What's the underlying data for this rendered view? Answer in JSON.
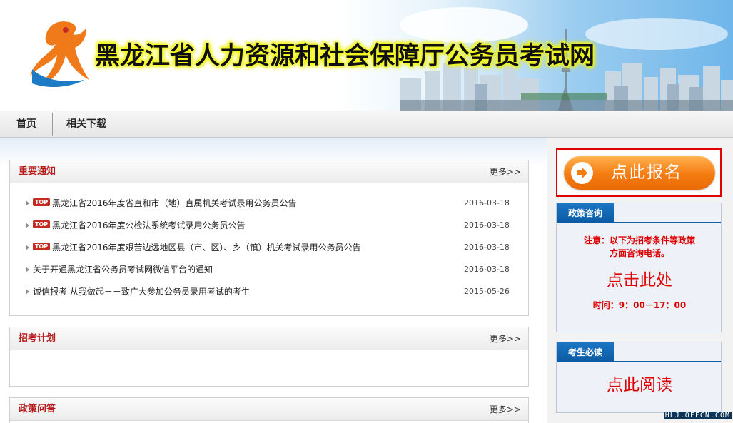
{
  "header": {
    "site_title": "黑龙江省人力资源和社会保障厅公务员考试网"
  },
  "nav": {
    "items": [
      {
        "label": "首页"
      },
      {
        "label": "相关下载"
      }
    ]
  },
  "notices": {
    "title": "重要通知",
    "more": "更多>>",
    "top_tag": "TOP",
    "items": [
      {
        "title": "黑龙江省2016年度省直和市（地）直属机关考试录用公务员公告",
        "date": "2016-03-18",
        "top": true
      },
      {
        "title": "黑龙江省2016年度公检法系统考试录用公务员公告",
        "date": "2016-03-18",
        "top": true
      },
      {
        "title": "黑龙江省2016年度艰苦边远地区县（市、区）、乡（镇）机关考试录用公务员公告",
        "date": "2016-03-18",
        "top": true
      },
      {
        "title": "关于开通黑龙江省公务员考试网微信平台的通知",
        "date": "2016-03-18",
        "top": false
      },
      {
        "title": "诚信报考 从我做起－－致广大参加公务员录用考试的考生",
        "date": "2015-05-26",
        "top": false
      }
    ]
  },
  "plan": {
    "title": "招考计划",
    "more": "更多>>"
  },
  "qa": {
    "title": "政策问答",
    "more": "更多>>"
  },
  "sidebar": {
    "signup_label": "点此报名",
    "policy": {
      "tab": "政策咨询",
      "note_line1": "注意：以下为招考条件等政策",
      "note_line2": "方面咨询电话。",
      "link": "点击此处",
      "hours": "时间：9：00－17：00"
    },
    "reading": {
      "tab": "考生必读",
      "link": "点此阅读"
    }
  },
  "watermark": "HLJ.OFFCN.COM",
  "colors": {
    "accent_red": "#b81c1c",
    "tab_blue": "#0b5aa2",
    "signup_orange": "#f57c11"
  }
}
